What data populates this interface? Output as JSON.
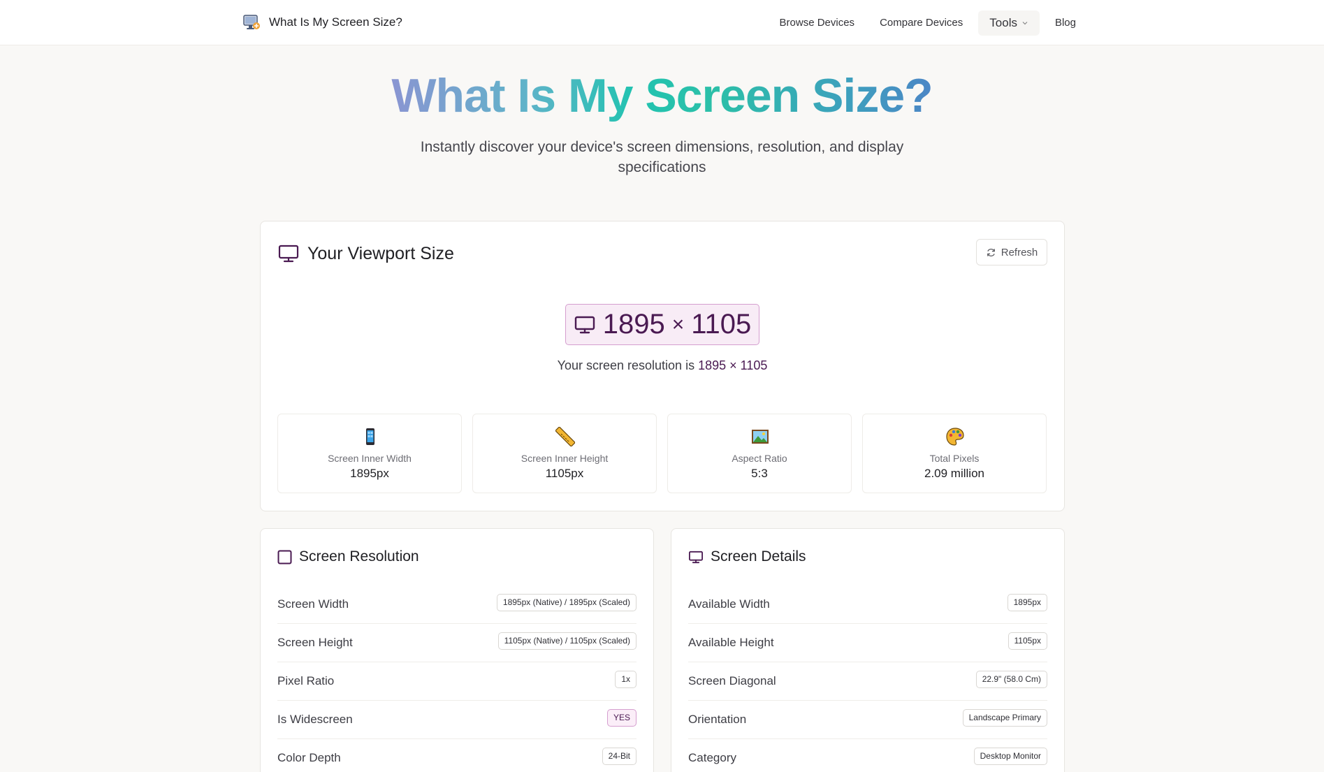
{
  "nav": {
    "brand": "What Is My Screen Size?",
    "links": [
      "Browse Devices",
      "Compare Devices",
      "Tools",
      "Blog"
    ]
  },
  "hero": {
    "title": "What Is My Screen Size?",
    "subtitle": "Instantly discover your device's screen dimensions, resolution, and display specifications"
  },
  "viewport": {
    "title": "Your Viewport Size",
    "refresh": "Refresh",
    "width": "1895",
    "times": "×",
    "height": "1105",
    "res_prefix": "Your screen resolution is",
    "res_value": "1895 × 1105",
    "stats": [
      {
        "icon": "phone-icon",
        "label": "Screen Inner Width",
        "value": "1895px"
      },
      {
        "icon": "ruler-icon",
        "label": "Screen Inner Height",
        "value": "1105px"
      },
      {
        "icon": "picture-icon",
        "label": "Aspect Ratio",
        "value": "5:3"
      },
      {
        "icon": "palette-icon",
        "label": "Total Pixels",
        "value": "2.09 million"
      }
    ]
  },
  "resolution": {
    "title": "Screen Resolution",
    "rows": [
      {
        "label": "Screen Width",
        "value": "1895px (Native) / 1895px (Scaled)"
      },
      {
        "label": "Screen Height",
        "value": "1105px (Native) / 1105px (Scaled)"
      },
      {
        "label": "Pixel Ratio",
        "value": "1x"
      },
      {
        "label": "Is Widescreen",
        "value": "YES"
      },
      {
        "label": "Color Depth",
        "value": "24-Bit"
      }
    ]
  },
  "details": {
    "title": "Screen Details",
    "rows": [
      {
        "label": "Available Width",
        "value": "1895px"
      },
      {
        "label": "Available Height",
        "value": "1105px"
      },
      {
        "label": "Screen Diagonal",
        "value": "22.9\" (58.0 Cm)"
      },
      {
        "label": "Orientation",
        "value": "Landscape Primary"
      },
      {
        "label": "Category",
        "value": "Desktop Monitor"
      }
    ]
  }
}
